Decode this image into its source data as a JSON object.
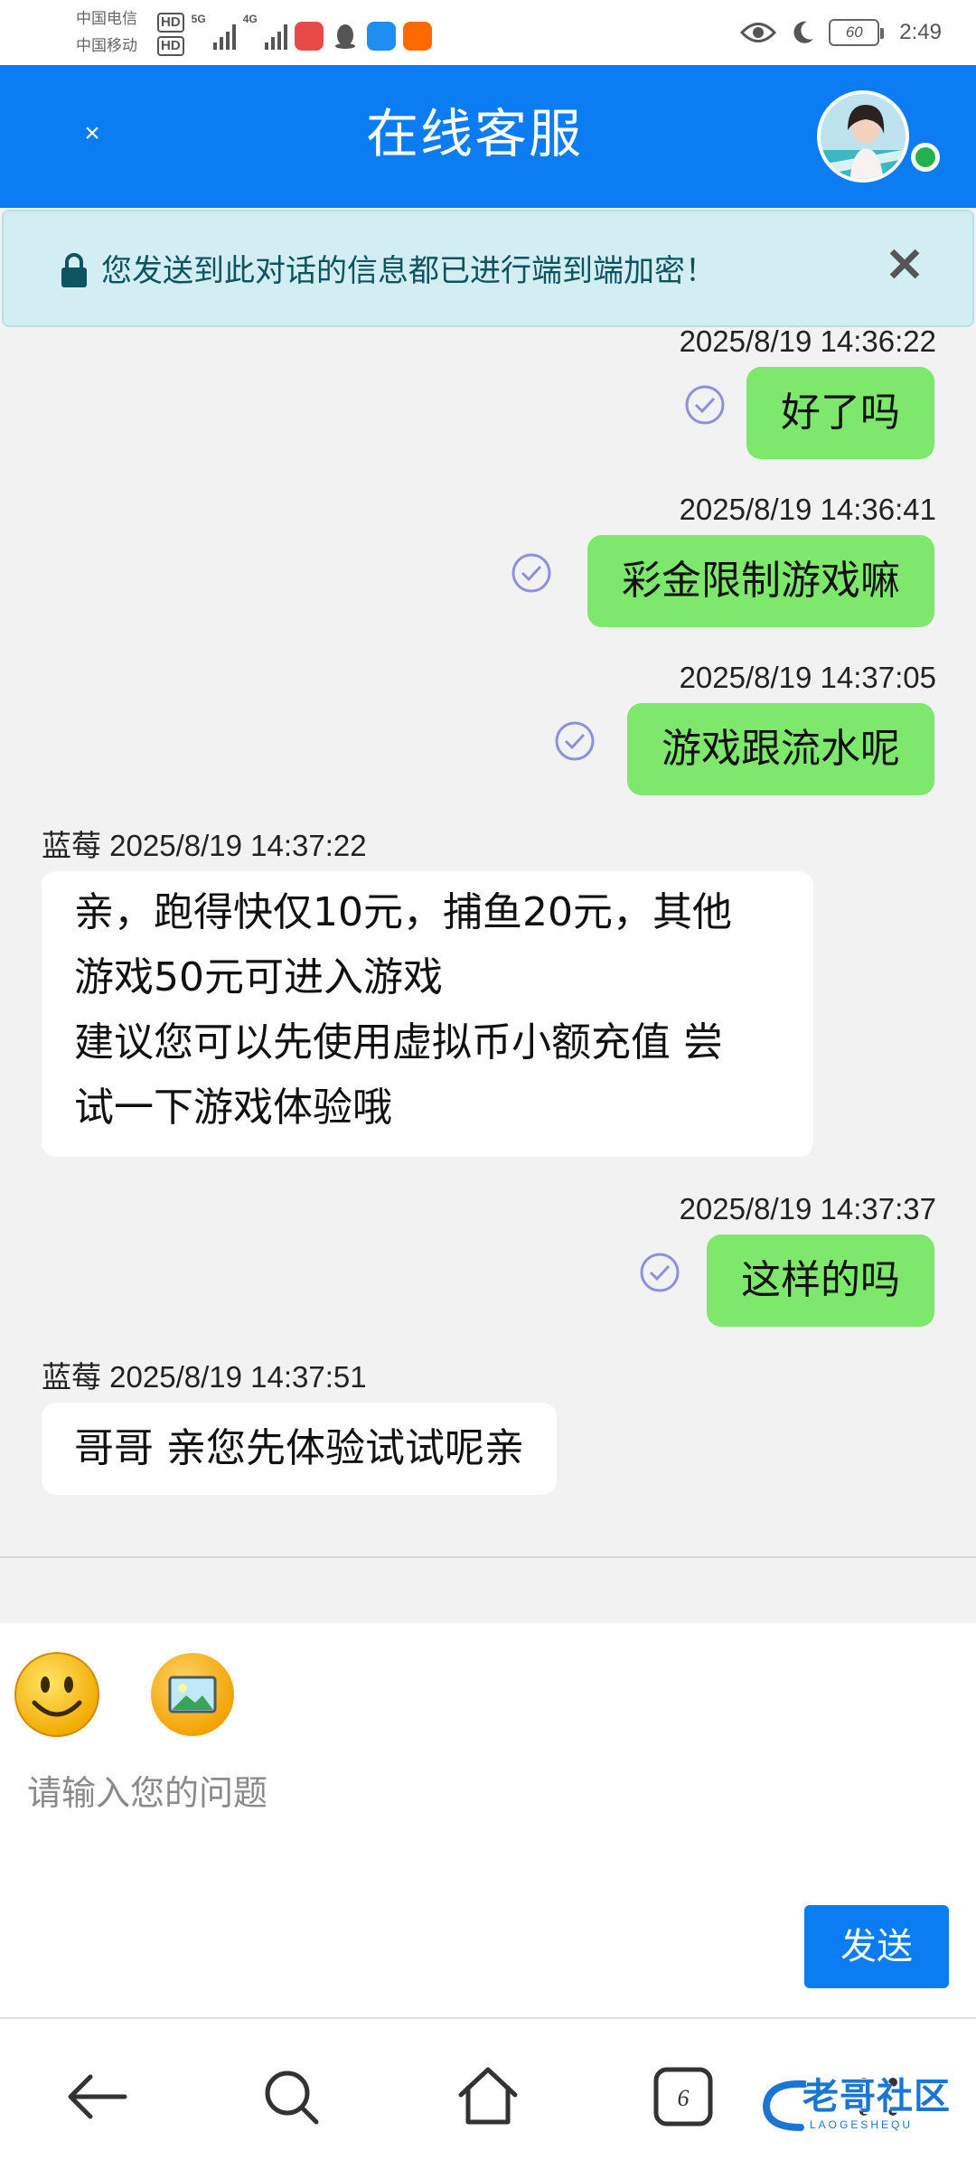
{
  "status_bar": {
    "carrier1": "中国电信",
    "carrier2": "中国移动",
    "hd": "HD",
    "net1": "5G",
    "net2": "4G",
    "battery": "60",
    "time": "2:49"
  },
  "header": {
    "close_label": "×",
    "title": "在线客服"
  },
  "banner": {
    "text": "您发送到此对话的信息都已进行端到端加密！",
    "close_label": "✕"
  },
  "messages": [
    {
      "side": "out",
      "time": "2025/8/19 14:36:22",
      "text": "好了吗"
    },
    {
      "side": "out",
      "time": "2025/8/19 14:36:41",
      "text": "彩金限制游戏嘛"
    },
    {
      "side": "out",
      "time": "2025/8/19 14:37:05",
      "text": "游戏跟流水呢"
    },
    {
      "side": "in",
      "sender_time": "蓝莓 2025/8/19 14:37:22",
      "lines": [
        "亲，跑得快仅10元，捕鱼20元，其他",
        "游戏50元可进入游戏",
        "建议您可以先使用虚拟币小额充值 尝",
        "试一下游戏体验哦"
      ]
    },
    {
      "side": "out",
      "time": "2025/8/19 14:37:37",
      "text": "这样的吗"
    },
    {
      "side": "in",
      "sender_time": "蓝莓 2025/8/19 14:37:51",
      "lines": [
        "哥哥 亲您先体验试试呢亲"
      ]
    }
  ],
  "composer": {
    "placeholder": "请输入您的问题",
    "send_label": "发送"
  },
  "watermark": {
    "text": "老哥社区",
    "sub": "LAOGESHEQU"
  },
  "colors": {
    "header": "#0b7cf2",
    "outgoing_bubble": "#7ee86c",
    "incoming_bubble": "#ffffff",
    "banner_bg": "#d3eef2",
    "online": "#22b14c"
  }
}
